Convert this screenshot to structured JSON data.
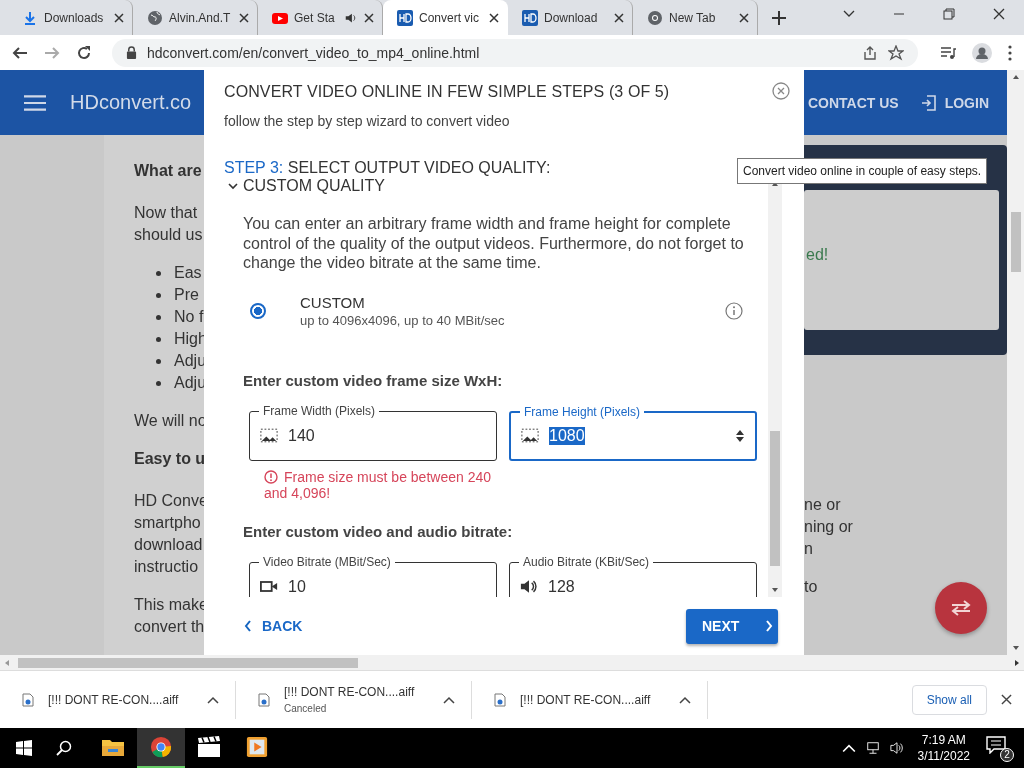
{
  "browser": {
    "tabs": [
      {
        "title": "Downloads",
        "kind": "download",
        "selected": false,
        "playing_audio": false
      },
      {
        "title": "Alvin.And.T",
        "kind": "globe",
        "selected": false,
        "playing_audio": false
      },
      {
        "title": "Get Sta",
        "kind": "youtube",
        "selected": false,
        "playing_audio": true
      },
      {
        "title": "Convert vic",
        "kind": "hd",
        "selected": true,
        "playing_audio": false
      },
      {
        "title": "Download",
        "kind": "hd",
        "selected": false,
        "playing_audio": false
      },
      {
        "title": "New Tab",
        "kind": "chrome",
        "selected": false,
        "playing_audio": false
      }
    ],
    "address": "hdconvert.com/en/convert_video_to_mp4_online.html"
  },
  "site": {
    "logo": "HDconvert.co",
    "nav": [
      {
        "label": "CONTACT US",
        "kind": "contact"
      },
      {
        "label": "LOGIN",
        "kind": "login"
      }
    ]
  },
  "page_left": [
    {
      "kind": "heading",
      "lines": [
        "What are"
      ]
    },
    {
      "kind": "para",
      "lines": [
        "Now that",
        "should us"
      ]
    },
    {
      "kind": "list",
      "lines": [
        "Eas",
        "Pre",
        "No f",
        "High",
        "Adju",
        "Adju"
      ]
    },
    {
      "kind": "para",
      "lines": [
        "We will no"
      ]
    },
    {
      "kind": "heading",
      "lines": [
        "Easy to u"
      ]
    },
    {
      "kind": "para",
      "lines": [
        "HD Conve",
        "smartpho",
        "download",
        "instructio"
      ]
    },
    {
      "kind": "para",
      "lines": [
        "This make",
        "convert th"
      ]
    }
  ],
  "status_panel": {
    "message": "ed!"
  },
  "page_right": [
    {
      "kind": "para",
      "lines": [
        "ne or",
        "ning or",
        "n"
      ]
    },
    {
      "kind": "para",
      "lines": [
        "to"
      ]
    }
  ],
  "tooltip": "Convert video online in couple of easy steps.",
  "wizard": {
    "title": "CONVERT VIDEO ONLINE IN FEW SIMPLE STEPS (3 OF 5)",
    "subtitle": "follow the step by step wizard to convert video",
    "step_label": "STEP 3:",
    "step_title": "SELECT OUTPUT VIDEO QUALITY:",
    "section": {
      "label": "CUSTOM QUALITY",
      "expanded": true
    },
    "description": "You can enter an arbitrary frame width and frame height for complete control of the quality of the output videos. Furthermore, do not forget to change the video bitrate at the same time.",
    "option": {
      "title": "CUSTOM",
      "detail": "up to 4096x4096, up to 40 MBit/sec",
      "selected": true
    },
    "size_heading": "Enter custom video frame size WxH:",
    "size_fields": [
      {
        "label": "Frame Width (Pixels)",
        "value": "140",
        "kind": "image",
        "focused": false
      },
      {
        "label": "Frame Height (Pixels)",
        "value": "1080",
        "kind": "image",
        "focused": true
      }
    ],
    "error": "Frame size must be between 240 and 4,096!",
    "bitrate_heading": "Enter custom video and audio bitrate:",
    "bitrate_fields": [
      {
        "label": "Video Bitrate (MBit/Sec)",
        "value": "10",
        "kind": "video",
        "focused": false
      },
      {
        "label": "Audio Bitrate (KBit/Sec)",
        "value": "128",
        "kind": "audio",
        "focused": false
      }
    ],
    "back": "BACK",
    "next": "NEXT"
  },
  "downloads": {
    "items": [
      {
        "name": "[!!! DONT RE-CON....aiff"
      },
      {
        "name": "[!!! DONT RE-CON....aiff",
        "status": "Canceled"
      },
      {
        "name": "[!!! DONT RE-CON....aiff"
      }
    ],
    "show_all": "Show all"
  },
  "taskbar": {
    "apps": [
      {
        "kind": "explorer",
        "selected": false
      },
      {
        "kind": "chrome",
        "selected": true
      },
      {
        "kind": "clapper",
        "selected": false
      },
      {
        "kind": "player",
        "selected": false
      }
    ],
    "time": "7:19 AM",
    "date": "3/11/2022",
    "notifications": "2"
  }
}
